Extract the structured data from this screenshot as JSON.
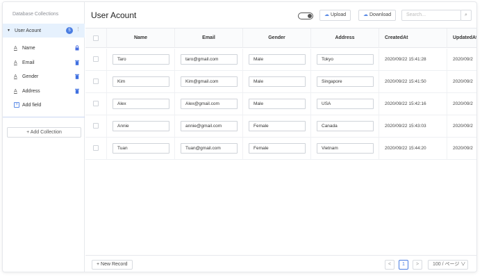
{
  "sidebar": {
    "title": "Database Collections",
    "collection": {
      "name": "User Acount",
      "count": "5",
      "more": "⋮"
    },
    "fields": [
      {
        "icon": "text-field-icon",
        "glyph": "A",
        "name": "Name",
        "action": "lock-icon",
        "action_color": "#4a6fe0"
      },
      {
        "icon": "text-field-icon",
        "glyph": "A",
        "name": "Email",
        "action": "trash-icon",
        "action_color": "#3f6fe0"
      },
      {
        "icon": "text-field-icon",
        "glyph": "A",
        "name": "Gender",
        "action": "trash-icon",
        "action_color": "#3f6fe0"
      },
      {
        "icon": "text-field-icon",
        "glyph": "A",
        "name": "Address",
        "action": "trash-icon",
        "action_color": "#3f6fe0"
      }
    ],
    "add_field": "Add field",
    "add_collection": "+ Add Collection"
  },
  "header": {
    "title": "User Acount",
    "upload": "Upload",
    "download": "Download",
    "search_placeholder": "Search...",
    "accent": "#4a7de2"
  },
  "table": {
    "columns": [
      "Name",
      "Email",
      "Gender",
      "Address",
      "CreatedAt",
      "UpdatedAt"
    ],
    "rows": [
      {
        "name": "Taro",
        "email": "taro@gmail.com",
        "gender": "Male",
        "address": "Tokyo",
        "created": "2020/09/22 15:41:28",
        "updated": "2020/09/2"
      },
      {
        "name": "Kim",
        "email": "Kim@gmail.com",
        "gender": "Male",
        "address": "Singapore",
        "created": "2020/09/22 15:41:50",
        "updated": "2020/09/2"
      },
      {
        "name": "Alex",
        "email": "Alex@gmail.com",
        "gender": "Male",
        "address": "USA",
        "created": "2020/09/22 15:42:16",
        "updated": "2020/09/2"
      },
      {
        "name": "Annie",
        "email": "annie@gmail.com",
        "gender": "Female",
        "address": "Canada",
        "created": "2020/09/22 15:43:03",
        "updated": "2020/09/2"
      },
      {
        "name": "Tuan",
        "email": "Tuan@gmail.com",
        "gender": "Female",
        "address": "Vietnam",
        "created": "2020/09/22 15:44:20",
        "updated": "2020/09/2"
      }
    ]
  },
  "footer": {
    "new_record": "+ New Record",
    "prev": "<",
    "page": "1",
    "next": ">",
    "page_size": "100 / ページ ∨"
  }
}
